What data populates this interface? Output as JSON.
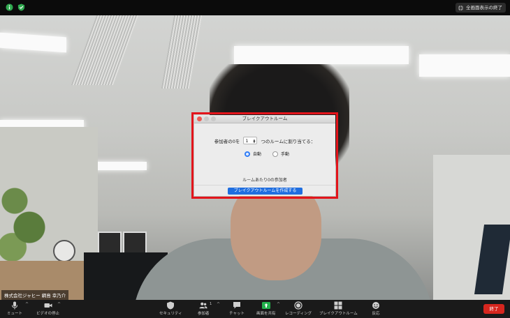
{
  "topbar": {
    "exit_fullscreen_label": "全画面表示の終了"
  },
  "video": {
    "participant_name": "株式会社ジャヒー 綱島 幸乃介"
  },
  "dialog": {
    "title": "ブレイクアウトルーム",
    "assign_prefix": "参加者の0を",
    "room_count": "1",
    "assign_suffix": "つのルームに割り当てる：",
    "auto_label": "自動",
    "manual_label": "手動",
    "selected_mode": "自動",
    "per_room_text": "ルームあたり0の参加者",
    "create_button": "ブレイクアウトルームを作成する"
  },
  "toolbar": {
    "mute": "ミュート",
    "stop_video": "ビデオの停止",
    "security": "セキュリティ",
    "participants": "参加者",
    "participants_count": "1",
    "chat": "チャット",
    "share_screen": "画面を共有",
    "record": "レコーディング",
    "breakout": "ブレイクアウトルーム",
    "reactions": "反応",
    "end": "終了"
  },
  "colors": {
    "accent": "#1f6ee0",
    "highlight": "#e3141b",
    "end": "#d7261e",
    "share": "#22b14c"
  }
}
